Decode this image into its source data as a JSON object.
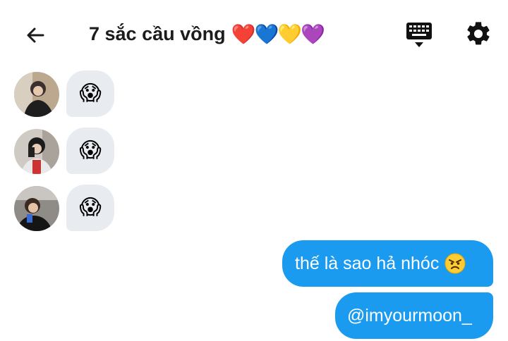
{
  "header": {
    "title": "7 sắc cầu vồng",
    "title_emoji": "❤️💙💛💜",
    "back_icon": "arrow-left-icon",
    "keyboard_icon": "keyboard-hide-icon",
    "settings_icon": "gear-icon"
  },
  "messages_in": [
    {
      "sender_avatar": "avatar-1",
      "emoji": "😱"
    },
    {
      "sender_avatar": "avatar-2",
      "emoji": "😱"
    },
    {
      "sender_avatar": "avatar-3",
      "emoji": "😱"
    }
  ],
  "messages_out": [
    {
      "text": "thế là sao hả nhóc",
      "emoji": "😠"
    },
    {
      "text": "@imyourmoon_"
    }
  ],
  "colors": {
    "outgoing_bubble": "#1a9bf0",
    "incoming_bubble": "#e8ecf0",
    "title_text": "#1c1c1c"
  }
}
